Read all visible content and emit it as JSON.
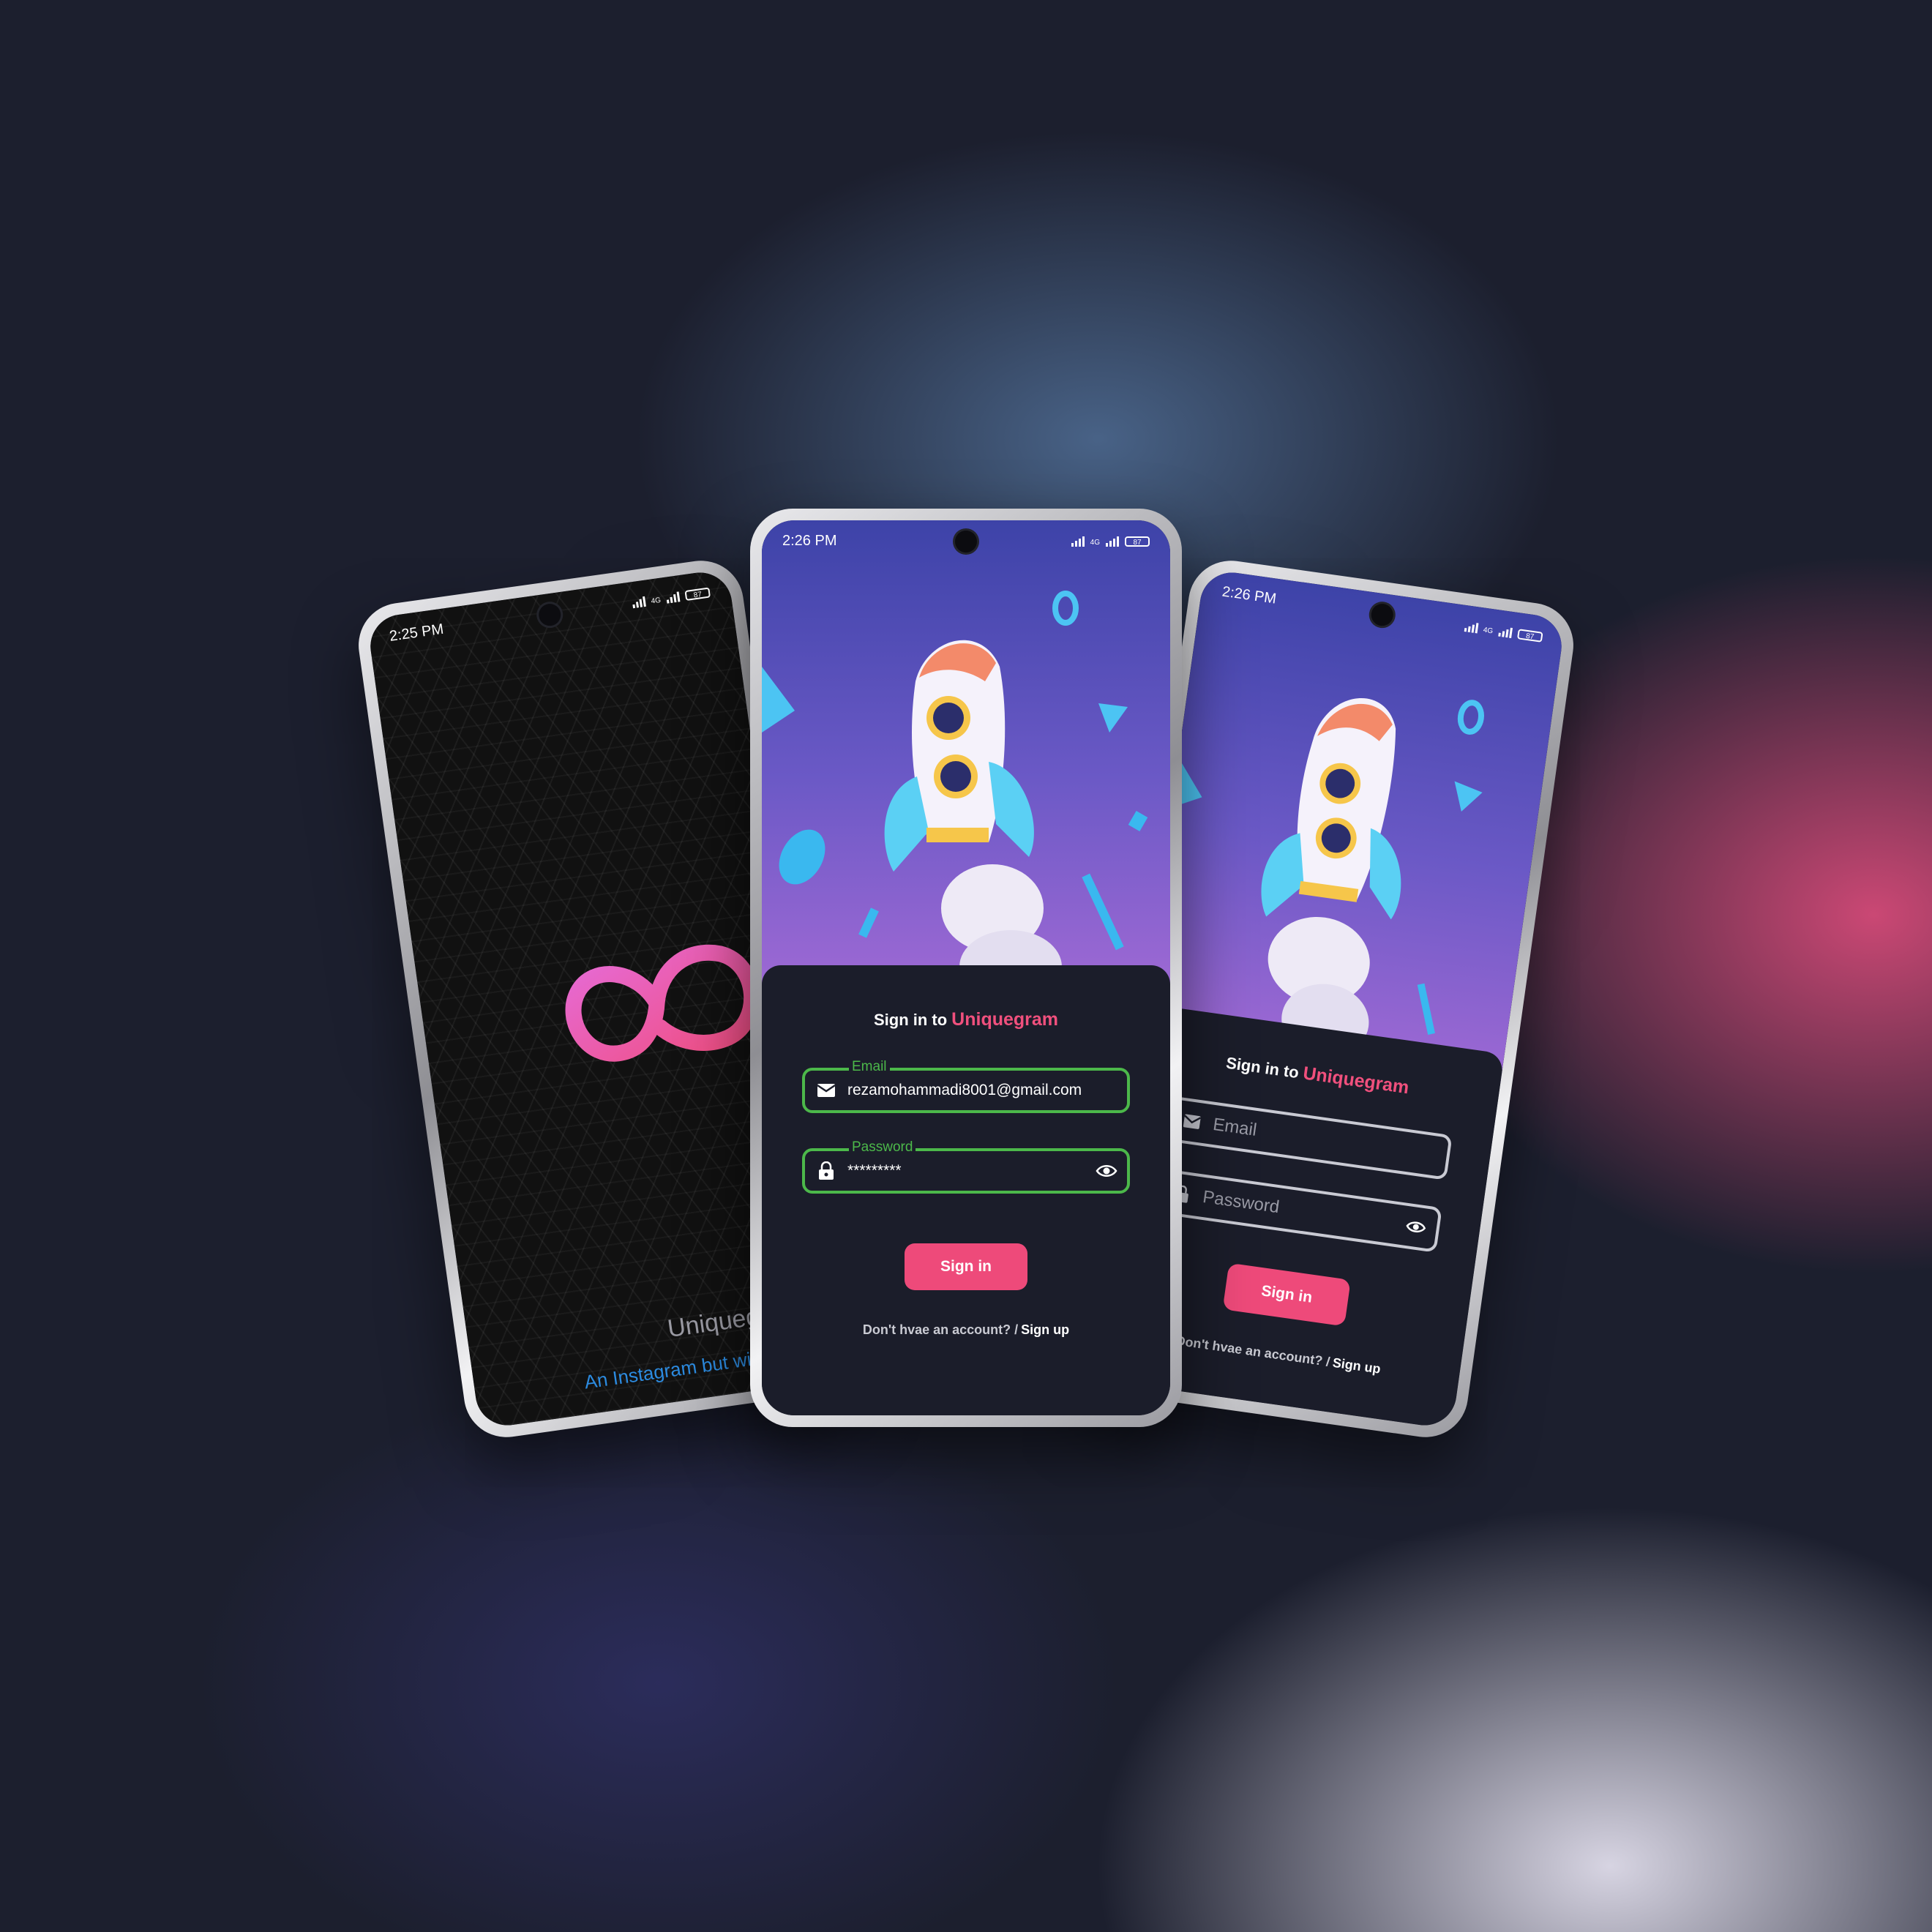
{
  "left_phone": {
    "status": {
      "time": "2:25 PM",
      "network": "4G",
      "battery": "87"
    },
    "app_name": "Uniquegram",
    "tagline": "An Instagram but with Uniq",
    "logo_gradient": [
      "#e66ad3",
      "#f04e82"
    ]
  },
  "center_phone": {
    "status": {
      "time": "2:26 PM",
      "network": "4G",
      "battery": "87"
    },
    "sign_in_prefix": "Sign in to",
    "brand": "Uniquegram",
    "email": {
      "label": "Email",
      "value": "rezamohammadi8001@gmail.com",
      "icon": "mail-icon"
    },
    "password": {
      "label": "Password",
      "value": "*********",
      "icon": "lock-icon",
      "toggle_icon": "eye-icon"
    },
    "sign_in_button": "Sign in",
    "footer": {
      "text": "Don't hvae an account? /",
      "link": "Sign up"
    }
  },
  "right_phone": {
    "status": {
      "time": "2:26 PM",
      "network": "4G",
      "battery": "87"
    },
    "sign_in_prefix": "Sign in to",
    "brand": "Uniquegram",
    "email_placeholder": "Email",
    "password_placeholder": "Password",
    "sign_in_button": "Sign in",
    "footer": {
      "text": "Don't hvae an account? /",
      "link": "Sign up"
    }
  },
  "colors": {
    "accent": "#ee4a7a",
    "brand_text": "#f0507d",
    "field_active": "#4cb84a",
    "panel_bg": "#1b1d2a",
    "tagline": "#2c8be0"
  }
}
